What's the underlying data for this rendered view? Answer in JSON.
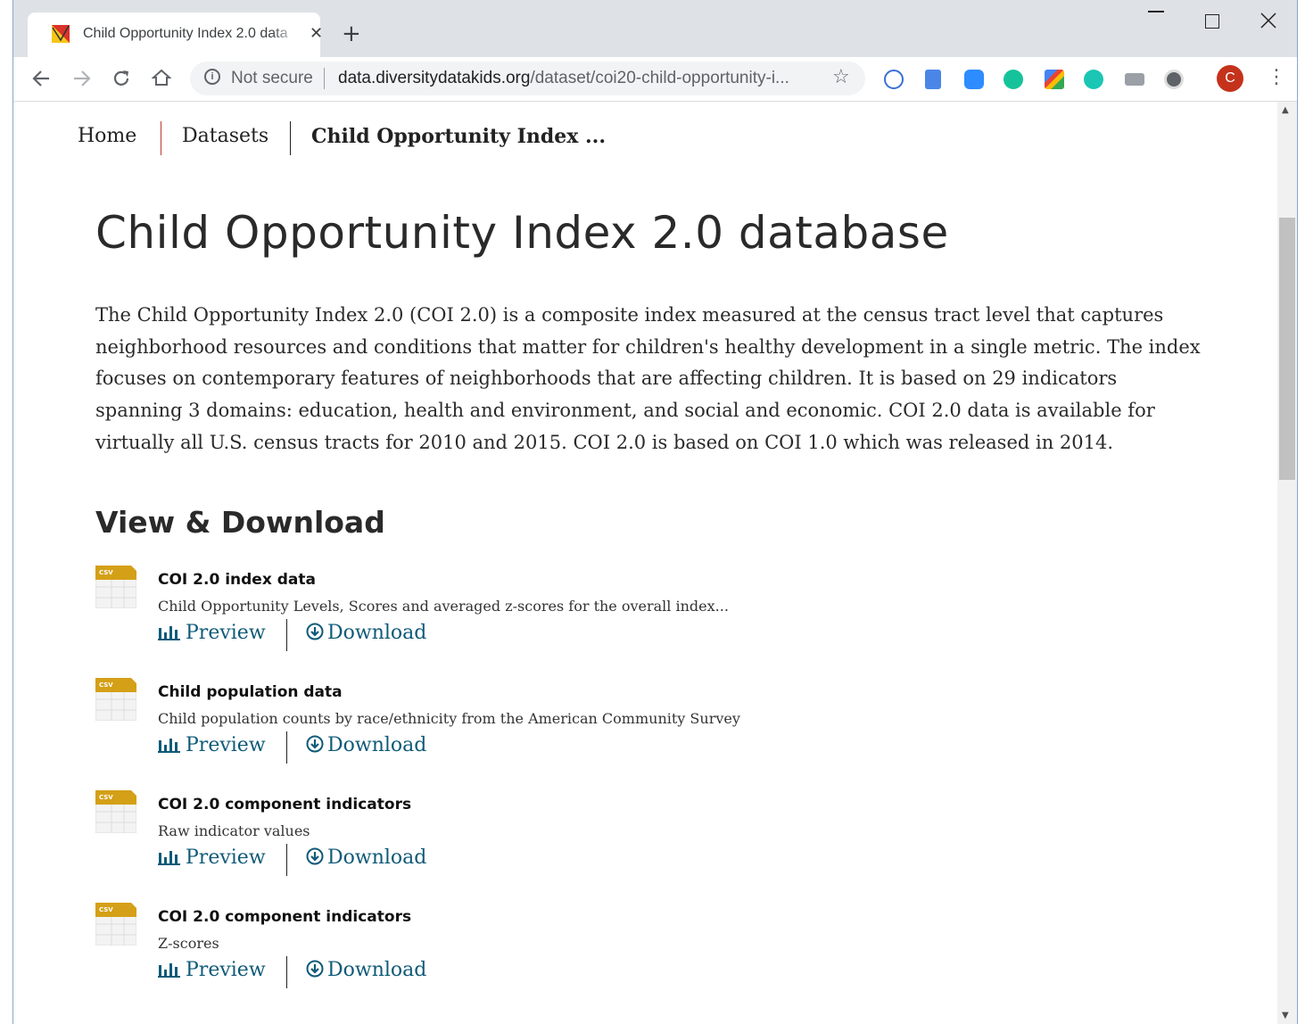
{
  "browser": {
    "tab_title": "Child Opportunity Index 2.0 data",
    "tab_close": "✕",
    "new_tab": "+",
    "security_label": "Not secure",
    "url_domain": "data.diversitydatakids.org",
    "url_path": "/dataset/coi20-child-opportunity-i...",
    "profile_initial": "C",
    "window_minimize": "—",
    "window_maximize": "☐",
    "window_close": "✕"
  },
  "breadcrumb": {
    "home": "Home",
    "datasets": "Datasets",
    "current": "Child Opportunity Index ..."
  },
  "page": {
    "title": "Child Opportunity Index 2.0 database",
    "description": "The Child Opportunity Index 2.0 (COI 2.0) is a composite index measured at the census tract level that captures neighborhood resources and conditions that matter for children's healthy development in a single metric. The index focuses on contemporary features of neighborhoods that are affecting children. It is based on 29 indicators spanning 3 domains: education, health and environment, and social and economic. COI 2.0 data is available for virtually all U.S. census tracts for 2010 and 2015. COI 2.0 is based on COI 1.0 which was released in 2014.",
    "section_title": "View & Download"
  },
  "resources": [
    {
      "name": "COI 2.0 index data",
      "description": "Child Opportunity Levels, Scores and averaged z-scores for the overall index...",
      "format": "csv",
      "preview": "Preview",
      "download": "Download"
    },
    {
      "name": "Child population data",
      "description": "Child population counts by race/ethnicity from the American Community Survey",
      "format": "csv",
      "preview": "Preview",
      "download": "Download"
    },
    {
      "name": "COI 2.0 component indicators",
      "description": "Raw indicator values",
      "format": "csv",
      "preview": "Preview",
      "download": "Download"
    },
    {
      "name": "COI 2.0 component indicators",
      "description": "Z-scores",
      "format": "csv",
      "preview": "Preview",
      "download": "Download"
    }
  ],
  "colors": {
    "link": "#0f5a78",
    "csv_icon": "#d4a017",
    "breadcrumb_separator": "#c0392b"
  }
}
